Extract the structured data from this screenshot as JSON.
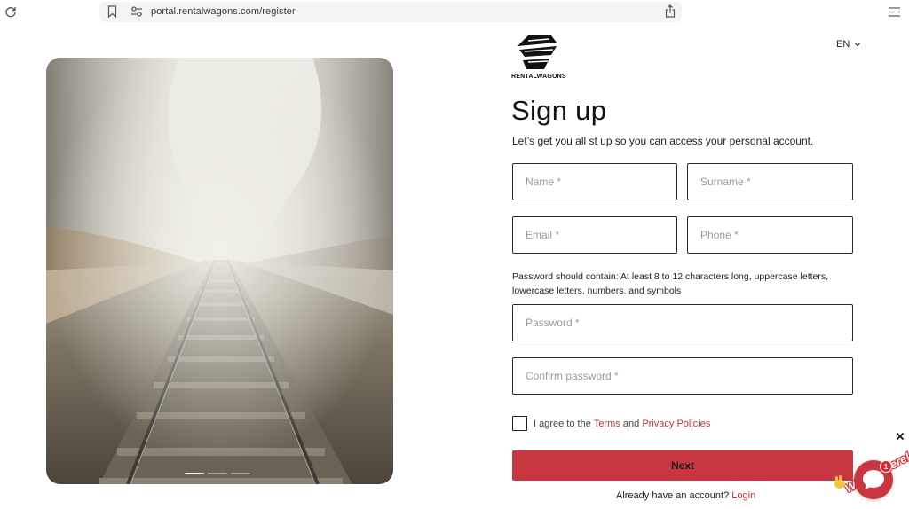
{
  "browser": {
    "url": "portal.rentalwagons.com/register",
    "icons": [
      "reload-icon",
      "bookmark-icon",
      "site-settings-icon",
      "share-icon",
      "menu-icon"
    ]
  },
  "brand": {
    "name": "RENTALWAGONS",
    "accent_color": "#c8373f"
  },
  "language": {
    "selected": "EN"
  },
  "form": {
    "title": "Sign up",
    "subtitle": "Let’s get you all st up so you can access your personal account.",
    "name_placeholder": "Name *",
    "surname_placeholder": "Surname *",
    "email_placeholder": "Email *",
    "phone_placeholder": "Phone *",
    "password_hint": "Password should contain: At least 8 to 12 characters long, uppercase letters, lowercase letters, numbers, and symbols",
    "password_placeholder": "Password *",
    "confirm_placeholder": "Confirm password *",
    "agree_prefix": "I agree to the",
    "terms_link": "Terms",
    "agree_and": "and",
    "privacy_link": "Privacy Policies",
    "next_label": "Next",
    "login_prompt": "Already have an account?",
    "login_link": "Login"
  },
  "chat": {
    "tag": "We Are Here!",
    "badge_count": "1"
  }
}
